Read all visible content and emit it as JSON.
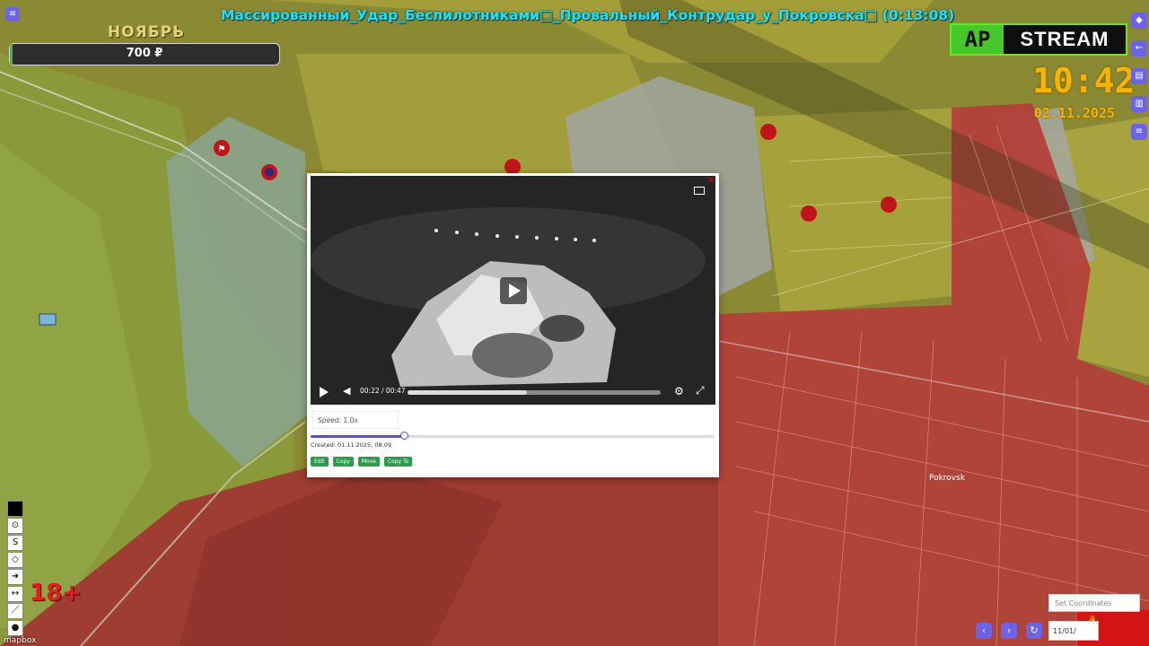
{
  "stream": {
    "title": "Массированный_Удар_Беспилотниками□_Провальный_Контрудар_у_Покровска□ (0:13:08)",
    "month": "НОЯБРЬ",
    "donation_amount": "700 ₽",
    "donation_progress": 0.01,
    "logo_left": "АР",
    "logo_right": "STREAM",
    "clock": "10:42",
    "date": "02.11.2025",
    "age_rating": "18+"
  },
  "map": {
    "city_label": "Pokrovsk",
    "attribution": "mapbox",
    "colors": {
      "russian_control": "#b03a36",
      "contested": "#9a9a2a",
      "ukrainian_control": "#7a8a3a",
      "gray_zone": "#9aa0a0"
    }
  },
  "video": {
    "time": "00:22 / 00:47",
    "progress": 0.47,
    "speed_label": "Speed: 1.0x",
    "speed_value": 0.23,
    "created": "Created: 01.11.2025, 08:09",
    "buttons": [
      "Edit",
      "Copy",
      "Move",
      "Copy To"
    ],
    "icons": [
      "play-icon",
      "volume-icon",
      "settings-icon",
      "fullscreen-icon",
      "pip-icon",
      "close-icon"
    ]
  },
  "controls": {
    "coordinates_placeholder": "Set Coordinates",
    "date_value": "11/01/",
    "tools": [
      "color-swatch",
      "marker-icon",
      "s-icon",
      "polygon-icon",
      "arrow-icon",
      "ruler-icon",
      "line-icon",
      "pin-icon"
    ],
    "rail_icons": [
      "app-icon",
      "back-icon",
      "layers-icon",
      "book-icon",
      "list-icon"
    ]
  }
}
